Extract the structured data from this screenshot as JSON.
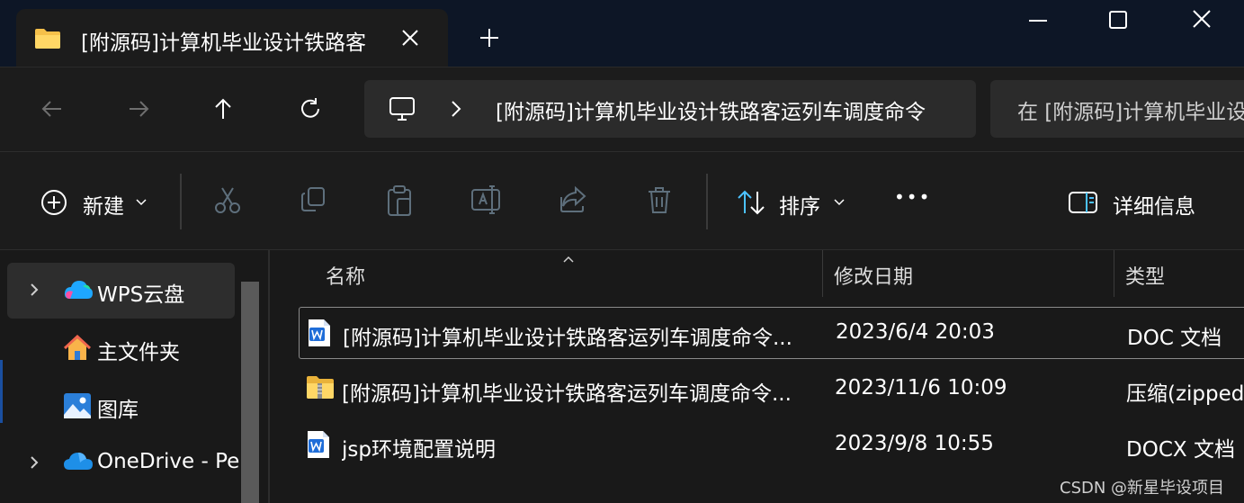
{
  "tab": {
    "title": "[附源码]计算机毕业设计铁路客",
    "folder_icon": "folder-icon",
    "close_icon": "close-icon"
  },
  "new_tab_icon": "plus-icon",
  "window_controls": [
    "minimize-icon",
    "maximize-icon",
    "close-icon"
  ],
  "navigation": {
    "back_icon": "arrow-left-icon",
    "forward_icon": "arrow-right-icon",
    "up_icon": "arrow-up-icon",
    "refresh_icon": "refresh-icon"
  },
  "address": {
    "root_icon": "this-pc-icon",
    "separator_icon": "chevron-right-icon",
    "path": "[附源码]计算机毕业设计铁路客运列车调度命令"
  },
  "search": {
    "placeholder": "在 [附源码]计算机毕业设计"
  },
  "toolbar": {
    "new_label": "新建",
    "sort_label": "排序",
    "more_label": "•••",
    "details_label": "详细信息",
    "icons": [
      "new-icon",
      "cut-icon",
      "copy-icon",
      "paste-icon",
      "rename-icon",
      "share-icon",
      "delete-icon",
      "sort-icon",
      "more-icon",
      "details-pane-icon"
    ]
  },
  "sidebar": {
    "items": [
      {
        "label": "WPS云盘",
        "icon": "wps-cloud-icon",
        "expandable": true,
        "selected": true
      },
      {
        "label": "主文件夹",
        "icon": "home-icon",
        "expandable": false,
        "selected": false
      },
      {
        "label": "图库",
        "icon": "gallery-icon",
        "expandable": false,
        "selected": false
      },
      {
        "label": "OneDrive - Pe",
        "icon": "onedrive-icon",
        "expandable": true,
        "selected": false
      }
    ]
  },
  "columns": {
    "name": "名称",
    "modified": "修改日期",
    "type": "类型"
  },
  "files": [
    {
      "name": "[附源码]计算机毕业设计铁路客运列车调度命令...",
      "modified": "2023/6/4 20:03",
      "type": "DOC 文档",
      "icon": "word-doc-icon"
    },
    {
      "name": "[附源码]计算机毕业设计铁路客运列车调度命令...",
      "modified": "2023/11/6 10:09",
      "type": "压缩(zipped",
      "icon": "zip-folder-icon"
    },
    {
      "name": "jsp环境配置说明",
      "modified": "2023/9/8 10:55",
      "type": "DOCX 文档",
      "icon": "word-doc-icon"
    }
  ],
  "watermark": "CSDN @新星毕设项目",
  "colors": {
    "background": "#191919",
    "titlebar": "#0d1626",
    "accent": "#4cc2ff",
    "folder": "#f7c948"
  }
}
